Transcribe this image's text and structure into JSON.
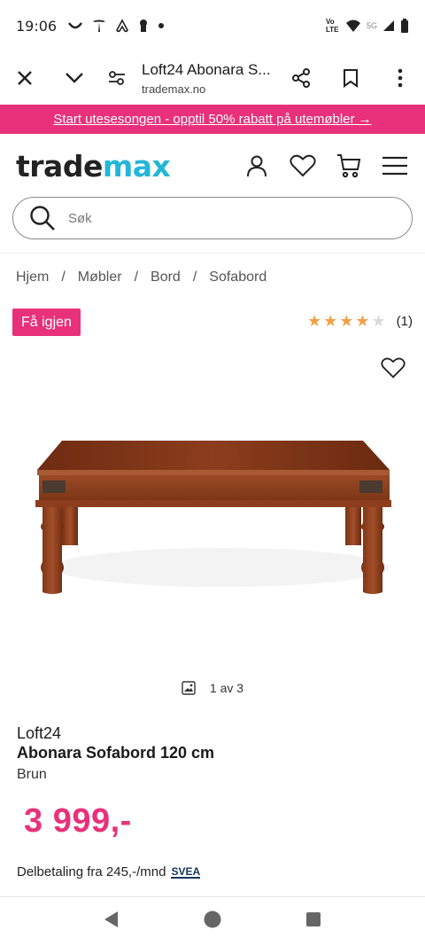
{
  "status": {
    "time": "19:06",
    "network_label": "Vo LTE",
    "signal_label": "5G"
  },
  "browser": {
    "title": "Loft24 Abonara S...",
    "domain": "trademax.no"
  },
  "promo": {
    "text": "Start utesesongen - opptil 50% rabatt på utemøbler →"
  },
  "header": {
    "logo_part1": "trade",
    "logo_part2": "max",
    "brand_color": "#24b6d6"
  },
  "search": {
    "placeholder": "Søk"
  },
  "breadcrumb": {
    "items": [
      "Hjem",
      "Møbler",
      "Bord",
      "Sofabord"
    ],
    "separator": "/"
  },
  "badge": {
    "label": "Få igjen",
    "color": "#e8317a"
  },
  "rating": {
    "stars": 4,
    "max": 5,
    "count": "(1)",
    "star_color": "#f0a04b"
  },
  "gallery": {
    "counter": "1 av 3"
  },
  "product": {
    "brand": "Loft24",
    "name": "Abonara Sofabord 120 cm",
    "color": "Brun",
    "price": "3 999,-",
    "installment": "Delbetaling fra 245,-/mnd",
    "installment_provider": "SVEA"
  }
}
